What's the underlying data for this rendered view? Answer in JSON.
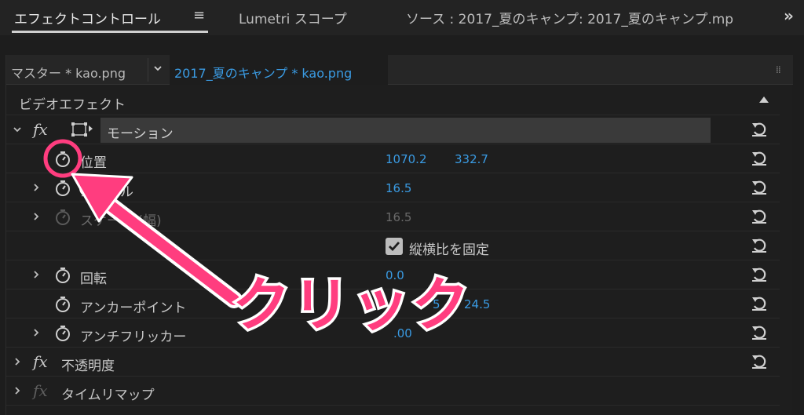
{
  "tabs": {
    "effect_controls": "エフェクトコントロール",
    "menu_icon": "≡",
    "lumetri": "Lumetri スコープ",
    "source": "ソース : 2017_夏のキャンプ: 2017_夏のキャンプ.mp",
    "overflow_icon": "»"
  },
  "subtabs": {
    "master": "マスター * kao.png",
    "clip": "2017_夏のキャンプ * kao.png"
  },
  "section": {
    "video_effects": "ビデオエフェクト"
  },
  "motion": {
    "fx": "fx",
    "label": "モーション",
    "position": {
      "label": "位置",
      "x": "1070.2",
      "y": "332.7"
    },
    "scale": {
      "label": "スケール",
      "value": "16.5"
    },
    "scale_width": {
      "label": "スケール (幅)",
      "value": "16.5"
    },
    "uniform_scale": {
      "label": "縦横比を固定",
      "checked": true
    },
    "rotation": {
      "label": "回転",
      "value": "0.0"
    },
    "anchor": {
      "label": "アンカーポイント",
      "x": "5",
      "y": "24.5"
    },
    "antiflicker": {
      "label": "アンチフリッカー",
      "value": ".00"
    }
  },
  "opacity": {
    "fx": "fx",
    "label": "不透明度"
  },
  "time_remap": {
    "fx": "fx",
    "label": "タイムリマップ"
  },
  "annotation": {
    "text": "クリック",
    "color": "#ff3d7f"
  },
  "colors": {
    "accent_blue": "#3a9be3",
    "background": "#1d1d1d"
  }
}
